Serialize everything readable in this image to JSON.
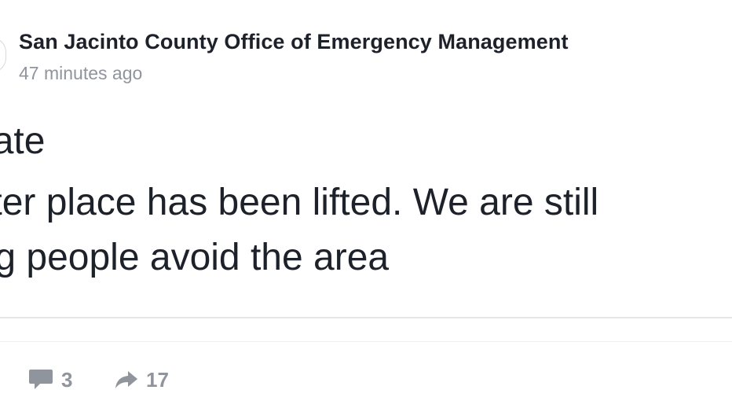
{
  "post": {
    "author": "San Jacinto County Office of Emergency Management",
    "timestamp": "47 minutes ago",
    "lines": [
      "date",
      "elter place has been lifted. We are still",
      "ing people avoid the area"
    ]
  },
  "actions": {
    "comments_count": "3",
    "shares_count": "17"
  },
  "icons": {
    "comment": "speech-bubble-icon",
    "share": "share-arrow-icon"
  },
  "colors": {
    "text": "#1d2129",
    "muted": "#90949c",
    "divider": "#e5e6e9"
  }
}
